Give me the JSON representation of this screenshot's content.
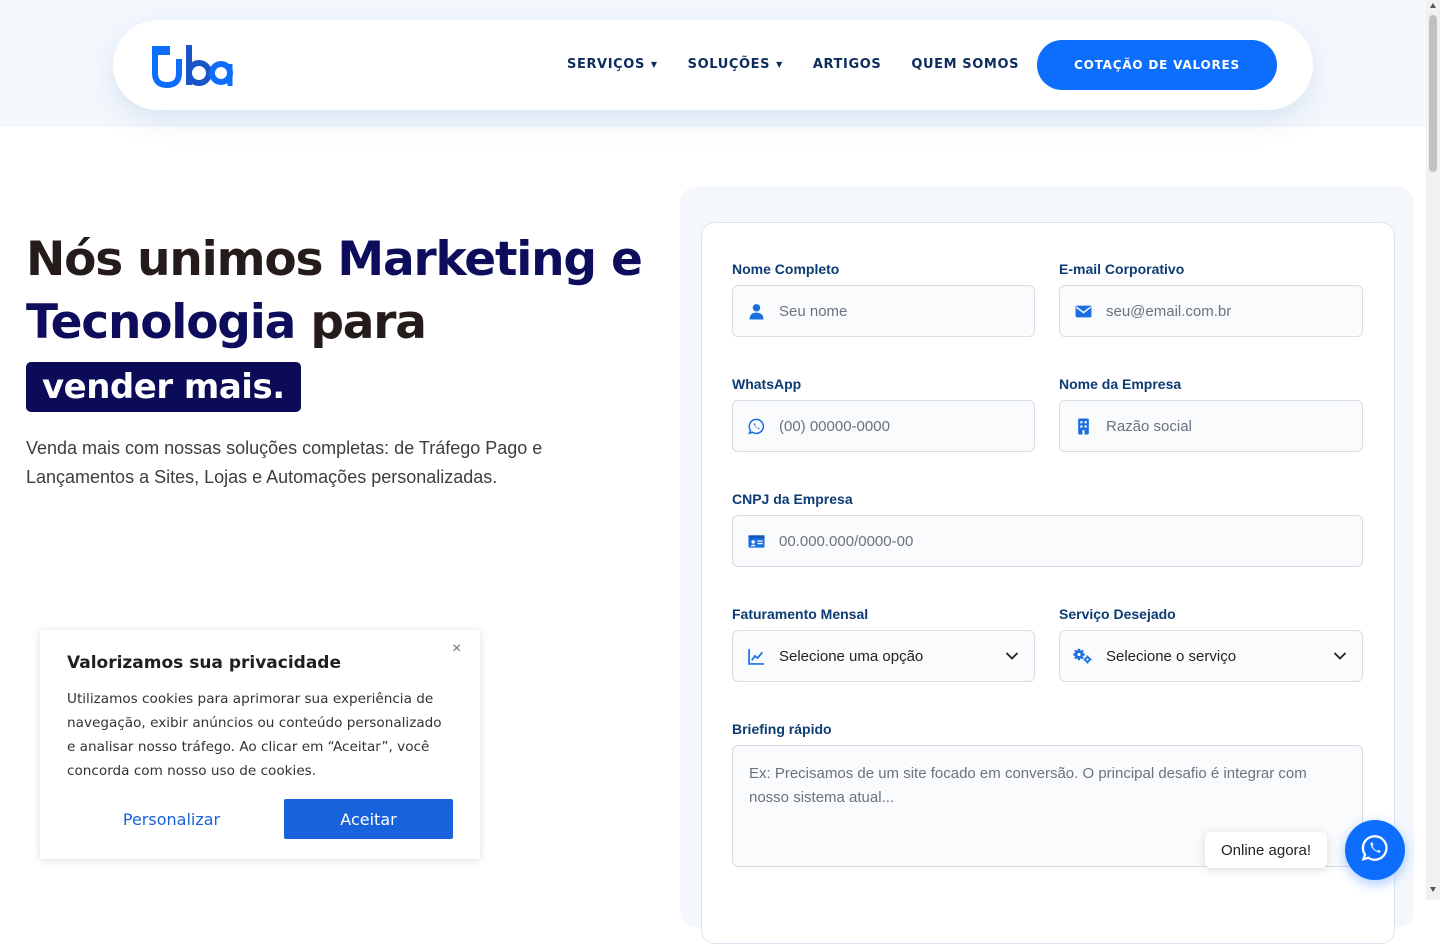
{
  "brand": {
    "logo_text": "uba",
    "color": "#0d6efd",
    "dark_color": "#0d2c5e"
  },
  "nav": {
    "items": [
      {
        "label": "SERVIÇOS",
        "has_dropdown": true
      },
      {
        "label": "SOLUÇÕES",
        "has_dropdown": true
      },
      {
        "label": "ARTIGOS",
        "has_dropdown": false
      },
      {
        "label": "QUEM SOMOS",
        "has_dropdown": false
      }
    ],
    "cta_label": "COTAÇÃO DE VALORES"
  },
  "hero": {
    "title_part1": "Nós unimos ",
    "title_accent1": "Marketing e Tecnologia",
    "title_part2": " para",
    "highlight": "vender mais.",
    "subtitle": "Venda mais com nossas soluções completas: de Tráfego Pago e Lançamentos a Sites, Lojas e Automações personalizadas."
  },
  "form": {
    "name": {
      "label": "Nome Completo",
      "placeholder": "Seu nome",
      "icon": "user-icon"
    },
    "email": {
      "label": "E-mail Corporativo",
      "placeholder": "seu@email.com.br",
      "icon": "envelope-icon"
    },
    "whatsapp": {
      "label": "WhatsApp",
      "placeholder": "(00) 00000-0000",
      "icon": "whatsapp-icon"
    },
    "company": {
      "label": "Nome da Empresa",
      "placeholder": "Razão social",
      "icon": "building-icon"
    },
    "cnpj": {
      "label": "CNPJ da Empresa",
      "placeholder": "00.000.000/0000-00",
      "icon": "id-card-icon"
    },
    "revenue": {
      "label": "Faturamento Mensal",
      "value": "Selecione uma opção",
      "icon": "chart-line-icon"
    },
    "service": {
      "label": "Serviço Desejado",
      "value": "Selecione o serviço",
      "icon": "gears-icon"
    },
    "briefing": {
      "label": "Briefing rápido",
      "placeholder": "Ex: Precisamos de um site focado em conversão. O principal desafio é integrar com nosso sistema atual..."
    }
  },
  "cookie": {
    "title": "Valorizamos sua privacidade",
    "text": "Utilizamos cookies para aprimorar sua experiência de navegação, exibir anúncios ou conteúdo personalizado e analisar nosso tráfego. Ao clicar em “Aceitar”, você concorda com nosso uso de cookies.",
    "customize_label": "Personalizar",
    "accept_label": "Aceitar",
    "close_symbol": "×"
  },
  "chat": {
    "tooltip": "Online agora!"
  }
}
